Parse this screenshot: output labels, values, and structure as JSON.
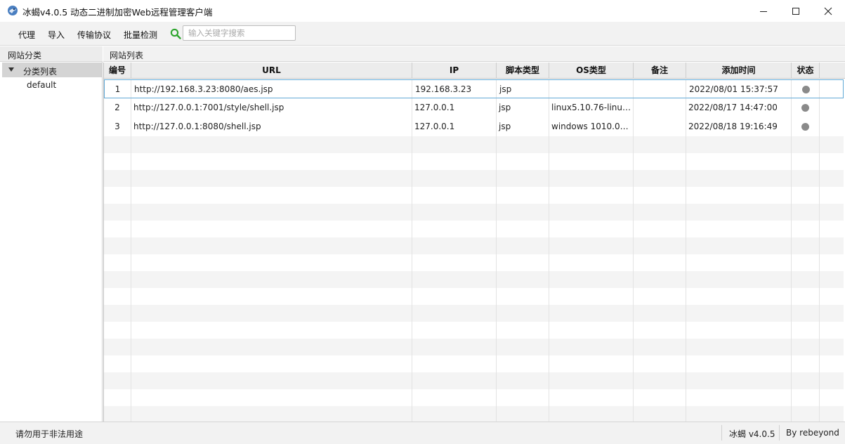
{
  "window": {
    "title": "冰蝎v4.0.5 动态二进制加密Web远程管理客户端",
    "icon": "scorpion-logo-icon"
  },
  "menu": {
    "items": [
      "代理",
      "导入",
      "传输协议",
      "批量检测"
    ]
  },
  "search": {
    "placeholder": "输入关键字搜索",
    "value": "",
    "icon": "search-icon",
    "color": "#2ea52e"
  },
  "left_panel": {
    "header": "网站分类",
    "tree_root": "分类列表",
    "tree_children": [
      "default"
    ]
  },
  "right_panel": {
    "header": "网站列表"
  },
  "table": {
    "columns": [
      "编号",
      "URL",
      "IP",
      "脚本类型",
      "OS类型",
      "备注",
      "添加时间",
      "状态"
    ],
    "rows": [
      {
        "id": "1",
        "url": "http://192.168.3.23:8080/aes.jsp",
        "ip": "192.168.3.23",
        "script": "jsp",
        "os": "",
        "note": "",
        "time": "2022/08/01 15:37:57",
        "selected": true
      },
      {
        "id": "2",
        "url": "http://127.0.0.1:7001/style/shell.jsp",
        "ip": "127.0.0.1",
        "script": "jsp",
        "os": "linux5.10.76-linux...",
        "note": "",
        "time": "2022/08/17 14:47:00",
        "selected": false
      },
      {
        "id": "3",
        "url": "http://127.0.0.1:8080/shell.jsp",
        "ip": "127.0.0.1",
        "script": "jsp",
        "os": "windows 1010.0a...",
        "note": "",
        "time": "2022/08/18 19:16:49",
        "selected": false
      }
    ],
    "status_color": "#8a8a8a",
    "selection_color": "#5ea8d6"
  },
  "statusbar": {
    "left": "请勿用于非法用途",
    "version": "冰蝎 v4.0.5",
    "author": "By rebeyond"
  }
}
